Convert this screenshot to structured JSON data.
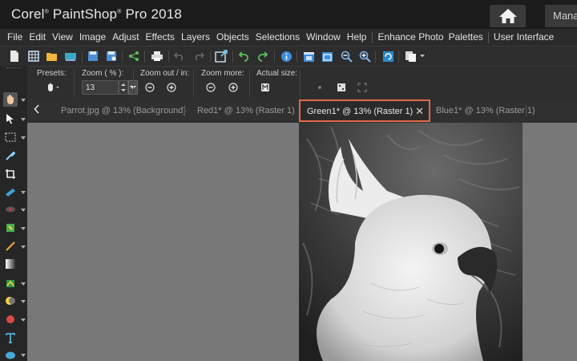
{
  "window": {
    "title_prefix": "Corel",
    "title_main": "PaintShop",
    "title_suffix": "Pro 2018",
    "manage_tab": "Manage"
  },
  "menu": [
    "File",
    "Edit",
    "View",
    "Image",
    "Adjust",
    "Effects",
    "Layers",
    "Objects",
    "Selections",
    "Window",
    "Help",
    "Enhance Photo",
    "Palettes",
    "User Interface"
  ],
  "tool_options": {
    "presets_label": "Presets:",
    "zoom_label": "Zoom ( % ):",
    "zoom_value": "13",
    "zoom_out_in_label": "Zoom out / in:",
    "zoom_more_label": "Zoom more:",
    "actual_size_label": "Actual size:"
  },
  "tabs": [
    {
      "label": "Parrot.jpg @  13% (Background)"
    },
    {
      "label": "Red1* @  13% (Raster 1)"
    },
    {
      "label": "Green1* @  13% (Raster 1)"
    },
    {
      "label": "Blue1* @  13% (Raster 1)"
    }
  ],
  "colors": {
    "accent": "#e26a4a",
    "workspace": "#787878",
    "chrome": "#2b2b2b"
  },
  "icons": {
    "home": "home-icon",
    "close": "close-icon",
    "prev": "chevron-left-icon"
  }
}
